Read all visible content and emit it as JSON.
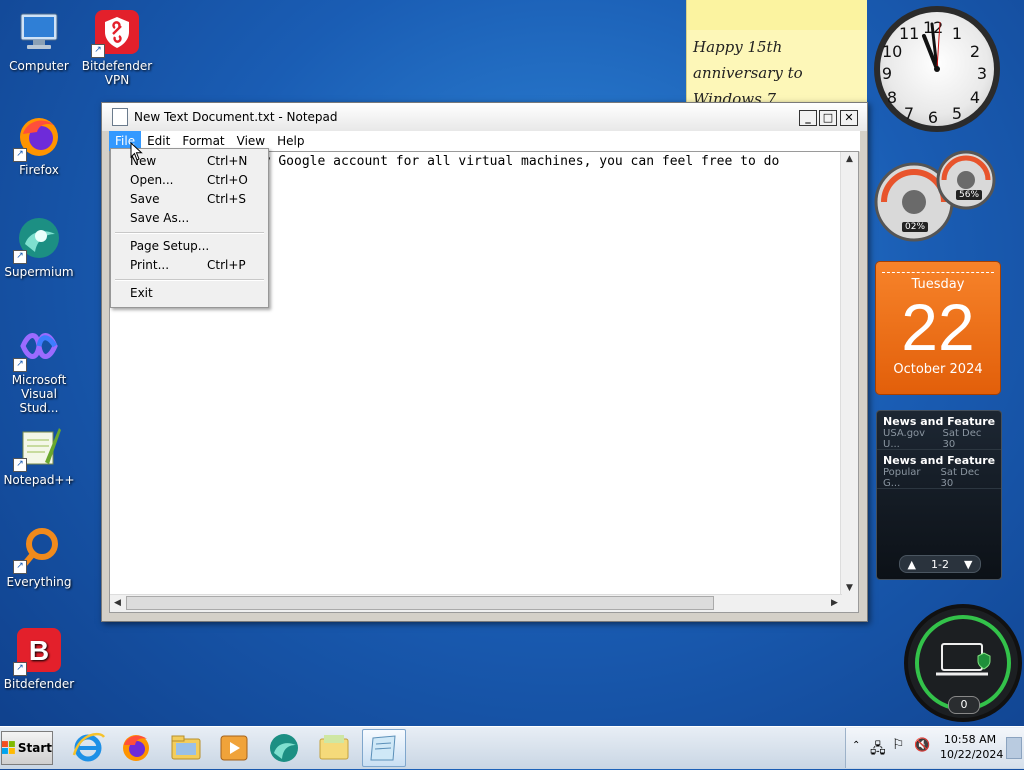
{
  "desktop": {
    "icons": [
      {
        "label": "Computer"
      },
      {
        "label": "Bitdefender VPN"
      },
      {
        "label": "Firefox"
      },
      {
        "label": "Supermium"
      },
      {
        "label": "Microsoft Visual Stud..."
      },
      {
        "label": "Notepad++"
      },
      {
        "label": "Everything"
      },
      {
        "label": "Bitdefender"
      }
    ]
  },
  "sticky_note": {
    "text": "Happy 15th\nanniversary to\nWindows 7"
  },
  "clock_gadget": {
    "numbers": [
      "12",
      "1",
      "2",
      "3",
      "4",
      "5",
      "6",
      "7",
      "8",
      "9",
      "10",
      "11"
    ]
  },
  "meter_gadget": {
    "cpu": "02%",
    "memory": "56%"
  },
  "calendar_gadget": {
    "weekday": "Tuesday",
    "day": "22",
    "month_year": "October 2024"
  },
  "feed_gadget": {
    "items": [
      {
        "title": "News and Features f...",
        "source": "USA.gov U...",
        "date": "Sat Dec 30"
      },
      {
        "title": "News and Features f...",
        "source": "Popular G...",
        "date": "Sat Dec 30"
      }
    ],
    "pager": "1-2"
  },
  "network_gadget": {
    "count": "0"
  },
  "notepad": {
    "title": "New Text Document.txt - Notepad",
    "menu": [
      "File",
      "Edit",
      "Format",
      "View",
      "Help"
    ],
    "content": "There is a community Google account for all virtual machines, you can feel free to do"
  },
  "file_menu": {
    "items": [
      {
        "label": "New",
        "shortcut": "Ctrl+N"
      },
      {
        "label": "Open...",
        "shortcut": "Ctrl+O"
      },
      {
        "label": "Save",
        "shortcut": "Ctrl+S"
      },
      {
        "label": "Save As...",
        "shortcut": ""
      },
      {
        "label": "Page Setup...",
        "shortcut": ""
      },
      {
        "label": "Print...",
        "shortcut": "Ctrl+P"
      },
      {
        "label": "Exit",
        "shortcut": ""
      }
    ]
  },
  "taskbar": {
    "start_label": "Start",
    "time": "10:58 AM",
    "date": "10/22/2024"
  },
  "colors": {
    "accent": "#3399ff",
    "desktop": "#1a5db4",
    "calendar": "#f26d12"
  }
}
